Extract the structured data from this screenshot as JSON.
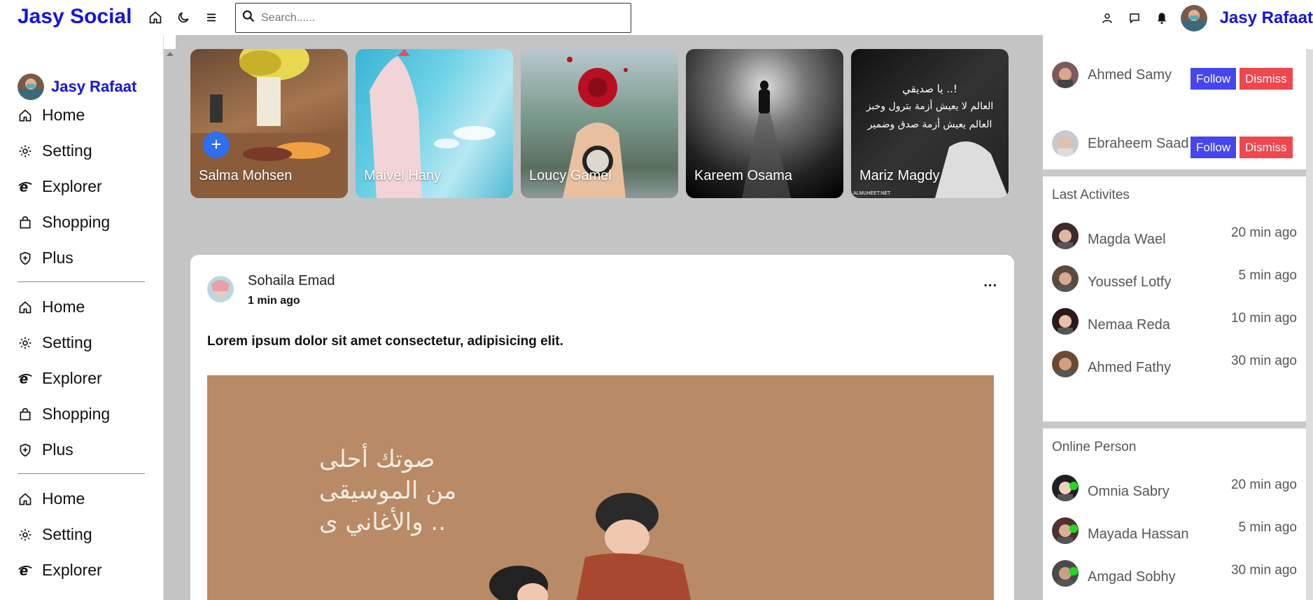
{
  "header": {
    "brand": "Jasy Social",
    "search_placeholder": "Search......",
    "user_name": "Jasy Rafaat",
    "icons": [
      "home-icon",
      "moon-icon",
      "menu-icon",
      "user-icon",
      "chat-icon",
      "bell-icon"
    ]
  },
  "sidebar": {
    "user_name": "Jasy Rafaat",
    "groups": [
      [
        {
          "label": "Home",
          "icon": "home-icon"
        },
        {
          "label": "Setting",
          "icon": "gear-icon"
        },
        {
          "label": "Explorer",
          "icon": "explorer-icon"
        },
        {
          "label": "Shopping",
          "icon": "bag-icon"
        },
        {
          "label": "Plus",
          "icon": "shield-icon"
        }
      ],
      [
        {
          "label": "Home",
          "icon": "home-icon"
        },
        {
          "label": "Setting",
          "icon": "gear-icon"
        },
        {
          "label": "Explorer",
          "icon": "explorer-icon"
        },
        {
          "label": "Shopping",
          "icon": "bag-icon"
        },
        {
          "label": "Plus",
          "icon": "shield-icon"
        }
      ],
      [
        {
          "label": "Home",
          "icon": "home-icon"
        },
        {
          "label": "Setting",
          "icon": "gear-icon"
        },
        {
          "label": "Explorer",
          "icon": "explorer-icon"
        }
      ]
    ]
  },
  "stories": [
    {
      "name": "Salma Mohsen",
      "add": "+"
    },
    {
      "name": "Maivel Hany"
    },
    {
      "name": "Loucy Gamel"
    },
    {
      "name": "Kareem Osama"
    },
    {
      "name": "Mariz Magdy",
      "overlay_lines": [
        "يا صديقي ..!",
        "العالم لا يعيش أزمة بترول وخبز",
        "العالم يعيش أزمة صدق وضمير"
      ],
      "watermark": "ALMUHEET.NET"
    }
  ],
  "post": {
    "author": "Sohaila Emad",
    "time": "1 min ago",
    "more": "...",
    "text": "Lorem ipsum dolor sit amet consectetur, adipisicing elit.",
    "image_lines": [
      "صوتك أحلى",
      "من الموسيقى",
      "والأغاني ى .."
    ]
  },
  "suggestions": {
    "follow_label": "Follow",
    "dismiss_label": "Dismiss",
    "people": [
      {
        "name": "Ahmed Samy"
      },
      {
        "name": "Ebraheem Saad"
      }
    ]
  },
  "activities": {
    "title": "Last Activites",
    "items": [
      {
        "name": "Magda Wael",
        "time": "20 min ago"
      },
      {
        "name": "Youssef Lotfy",
        "time": "5 min ago"
      },
      {
        "name": "Nemaa Reda",
        "time": "10 min ago"
      },
      {
        "name": "Ahmed Fathy",
        "time": "30 min ago"
      }
    ]
  },
  "online": {
    "title": "Online Person",
    "items": [
      {
        "name": "Omnia Sabry",
        "time": "20 min ago"
      },
      {
        "name": "Mayada Hassan",
        "time": "5 min ago"
      },
      {
        "name": "Amgad Sobhy",
        "time": "30 min ago"
      }
    ]
  },
  "colors": {
    "brand": "#1414e0",
    "follow": "#4646f0",
    "dismiss": "#f0464e",
    "story_add": "#2d6ef2",
    "online": "#1cdc1c"
  }
}
